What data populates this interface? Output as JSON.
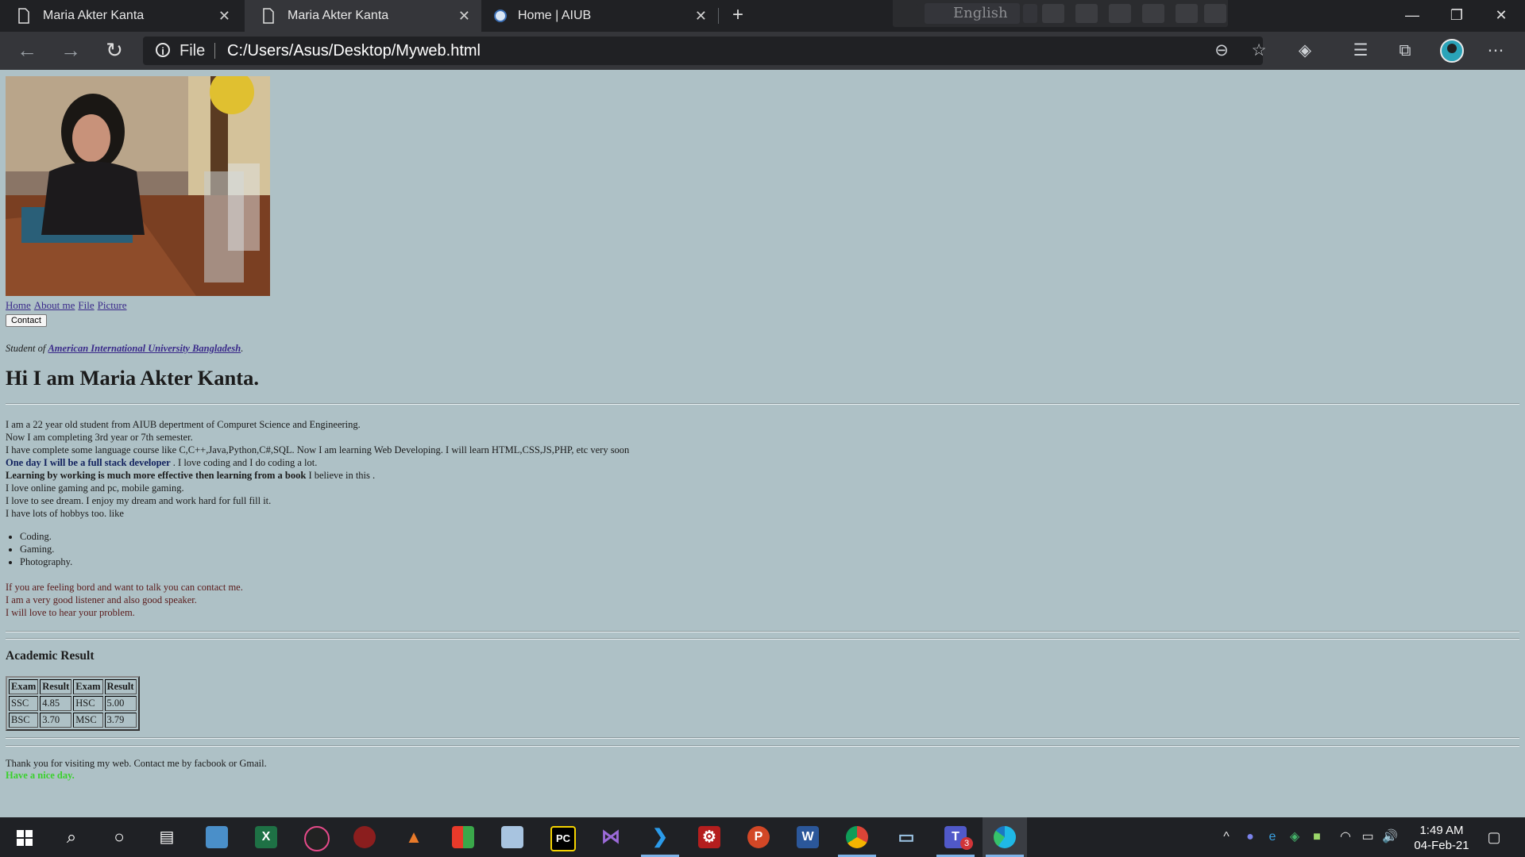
{
  "browser": {
    "tabs": [
      {
        "title": "Maria Akter Kanta",
        "icon": "page-icon",
        "active": false
      },
      {
        "title": "Maria Akter Kanta",
        "icon": "page-icon",
        "active": true
      },
      {
        "title": "Home | AIUB",
        "icon": "site-icon",
        "active": false
      }
    ],
    "language_toolbar": {
      "selected": "English"
    },
    "address": {
      "scheme_label": "File",
      "url": "C:/Users/Asus/Desktop/Myweb.html"
    }
  },
  "page": {
    "nav_links": [
      "Home",
      "About me",
      "File",
      "Picture"
    ],
    "contact_button": "Contact",
    "student_prefix": "Student of",
    "university": "American International University Bangladesh",
    "student_suffix": ".",
    "headline": "Hi I am Maria Akter Kanta.",
    "bio": {
      "line1": "I am a 22 year old student from AIUB depertment of Compuret Science and Engineering.",
      "line2": "Now I am completing 3rd year or 7th semester.",
      "line3": "I have complete some language course like C,C++,Java,Python,C#,SQL. Now I am learning Web Developing. I will learn HTML,CSS,JS,PHP, etc very soon",
      "line4_bold": "One day I will be a full stack developer",
      "line4_rest": " . I love coding and I do coding a lot.",
      "line5_bold": "Learning by working is much more effective then learning from a book",
      "line5_rest": " I believe in this .",
      "line6": "I love online gaming and pc, mobile gaming.",
      "line7": "I love to see dream. I enjoy my dream and work hard for full fill it.",
      "line8": "I have lots of hobbys too. like"
    },
    "hobbies": [
      "Coding.",
      "Gaming.",
      "Photography."
    ],
    "contact_para": [
      "If you are feeling bord and want to talk you can contact me.",
      "I am a very good listener and also good speaker.",
      "I will love to hear your problem."
    ],
    "academic_title": "Academic Result",
    "results_table": {
      "headers": [
        "Exam",
        "Result",
        "Exam",
        "Result"
      ],
      "rows": [
        [
          "SSC",
          "4.85",
          "HSC",
          "5.00"
        ],
        [
          "BSC",
          "3.70",
          "MSC",
          "3.79"
        ]
      ]
    },
    "thanks": "Thank you for visiting my web. Contact me by facbook or Gmail.",
    "greeting": "Have a nice day."
  },
  "colors": {
    "page_background": "#aec1c6",
    "link": "#3a2a8a",
    "greeting": "#39d12b",
    "browser_dark": "#202124"
  },
  "taskbar": {
    "apps": [
      "start-icon",
      "search-icon",
      "cortana-icon",
      "task-view-icon",
      "photos-icon",
      "excel-icon",
      "app-icon",
      "speed-icon",
      "matlab-icon",
      "app-icon",
      "box-icon",
      "pycharm-icon",
      "visual-studio-icon",
      "vscode-icon",
      "settings-icon",
      "powerpoint-icon",
      "word-icon",
      "chrome-icon",
      "laptop-icon",
      "teams-icon",
      "edge-icon"
    ],
    "teams_badge": "3",
    "time": "1:49 AM",
    "date": "04-Feb-21"
  }
}
